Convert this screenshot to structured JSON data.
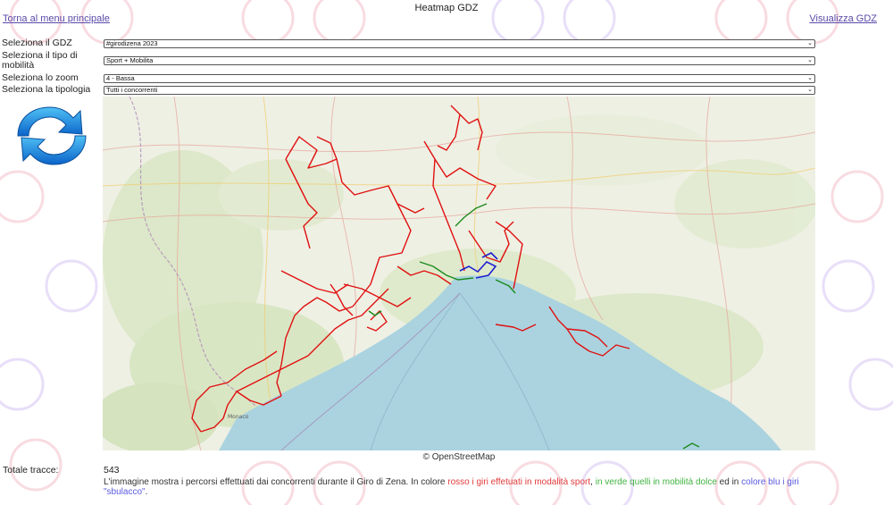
{
  "header": {
    "title": "Heatmap GDZ",
    "back_link": "Torna al menu principale",
    "view_link": "Visualizza GDZ"
  },
  "form": {
    "gdz_label": "Seleziona il GDZ",
    "gdz_value": "#girodizena 2023",
    "mobility_label": "Seleziona il tipo di mobilità",
    "mobility_value": "Sport + Mobilita",
    "zoom_label": "Seleziona lo zoom",
    "zoom_value": "4 - Bassa",
    "type_label": "Seleziona la tipologia",
    "type_value": "Tutti i concorrenti"
  },
  "map": {
    "credit": "© OpenStreetMap",
    "place_labels": [
      "Monaco"
    ]
  },
  "stats": {
    "total_label": "Totale tracce:",
    "total_value": "543"
  },
  "description": {
    "part1": "L'immagine mostra i percorsi effettuati dai concorrenti durante il Giro di Zena. In colore ",
    "red_text": "rosso i giri effetuati in modalità sport",
    "part2": ", ",
    "green_text": "in verde quelli in mobilità dolce",
    "part3": " ed in ",
    "blue_text": "colore blu i giri \"sbulacco\"",
    "part4": "."
  },
  "colors": {
    "sport": "#e01010",
    "mobility": "#1c8a1c",
    "sbulacco": "#2020d0",
    "sea": "#aad3df",
    "link": "#5a4aa8"
  },
  "icons": {
    "refresh": "refresh-icon",
    "dropdown": "chevron-down-icon"
  }
}
